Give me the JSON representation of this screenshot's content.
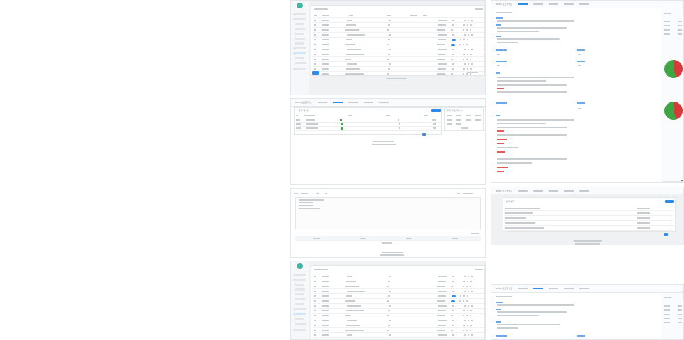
{
  "panels": {
    "top_right": {
      "header_title": "WEBA 포트폴리오"
    },
    "middle_center": {
      "header_title": "WEBA 포트폴리오",
      "section_title": "문제 게시판",
      "side_title": "문제 카테고리 (0)"
    },
    "middle_right": {
      "header_title": "WEBA 포트폴리오",
      "section_title": "공지 문제"
    },
    "bottom_right": {
      "header_title": "WEBA 포트폴리오"
    }
  },
  "colors": {
    "accent": "#2d8ceb",
    "pie_red": "#d63b3b",
    "pie_green": "#3da643",
    "logo": "#3fb6a8"
  }
}
